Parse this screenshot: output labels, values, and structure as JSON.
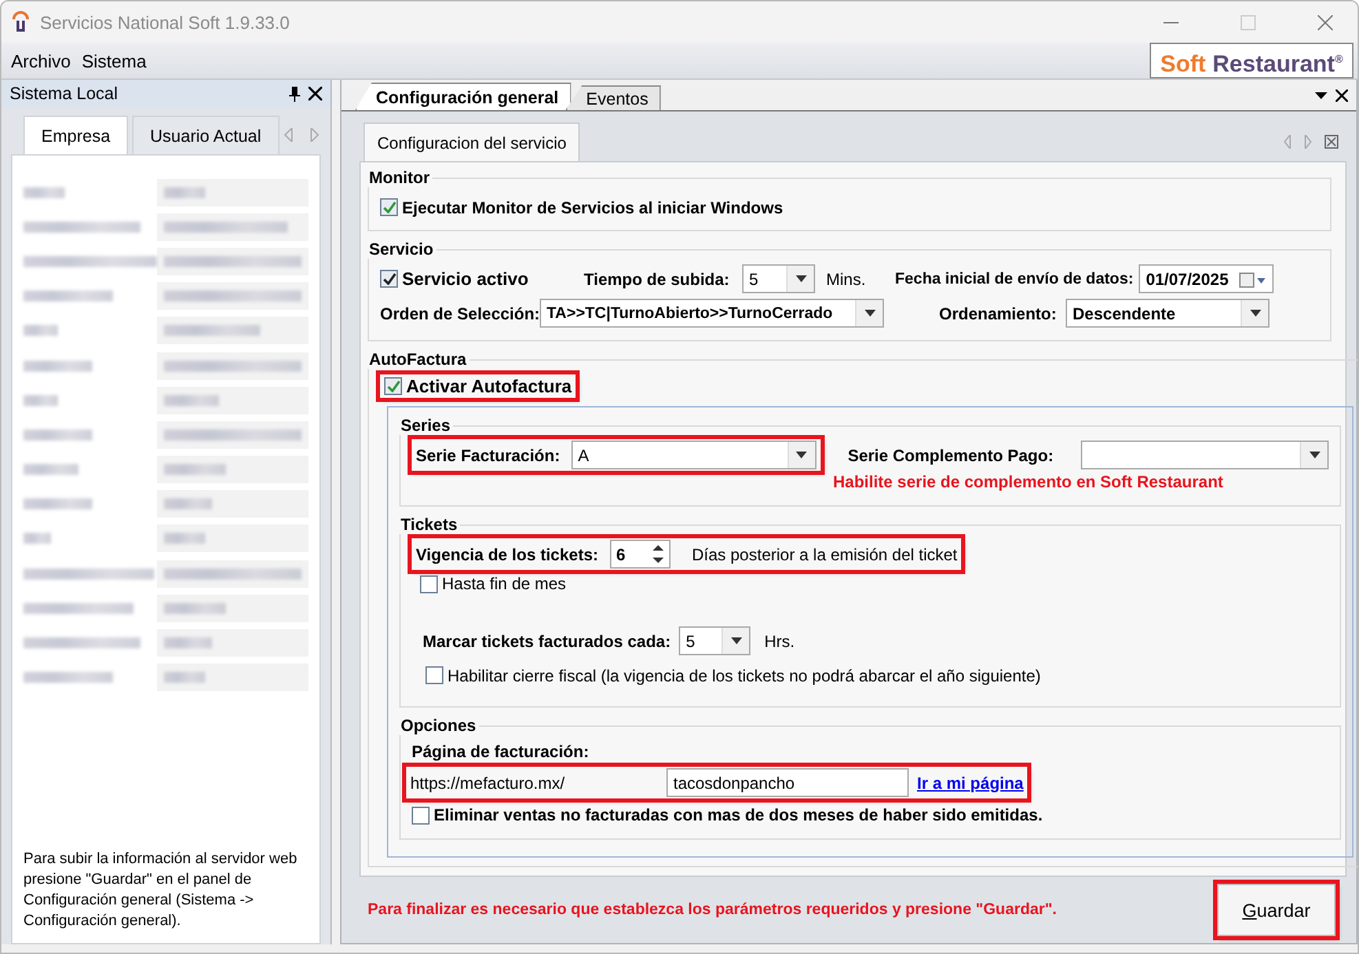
{
  "window": {
    "title": "Servicios National Soft 1.9.33.0"
  },
  "menu": [
    "Archivo",
    "Sistema"
  ],
  "logo": {
    "words": [
      "Soft",
      "Restaurant"
    ],
    "mark": "®"
  },
  "left_panel": {
    "title": "Sistema Local",
    "tabs": [
      {
        "label": "Empresa",
        "selected": true
      },
      {
        "label": "Usuario Actual",
        "selected": false
      }
    ],
    "note": "Para subir la información al servidor web presione \"Guardar\" en el panel de Configuración general (Sistema -> Configuración general)."
  },
  "doc_tabs": [
    {
      "label": "Configuración general",
      "selected": true
    },
    {
      "label": "Eventos",
      "selected": false
    }
  ],
  "inner_tabs": [
    {
      "label": "Configuracion del servicio",
      "selected": true
    }
  ],
  "monitor": {
    "title": "Monitor",
    "checkbox": {
      "label": "Ejecutar Monitor de Servicios al iniciar Windows",
      "checked": true
    }
  },
  "servicio": {
    "title": "Servicio",
    "active": {
      "label": "Servicio activo",
      "checked": true
    },
    "upload_time": {
      "label": "Tiempo de subida:",
      "value": "5",
      "unit": "Mins."
    },
    "start_date": {
      "label": "Fecha inicial de envío de datos:",
      "value": "01/07/2025"
    },
    "order": {
      "label": "Orden de Selección:",
      "value": "TA>>TC|TurnoAbierto>>TurnoCerrado"
    },
    "sorting": {
      "label": "Ordenamiento:",
      "value": "Descendente"
    }
  },
  "autofactura": {
    "title": "AutoFactura",
    "activate": {
      "label": "Activar Autofactura",
      "checked": true,
      "highlighted": true
    },
    "series": {
      "title": "Series",
      "invoice_series": {
        "label": "Serie Facturación:",
        "value": "A",
        "highlighted": true
      },
      "complement_series": {
        "label": "Serie Complemento Pago:"
      },
      "warning": "Habilite serie de complemento en Soft Restaurant"
    },
    "tickets": {
      "title": "Tickets",
      "validity": {
        "label": "Vigencia de los tickets:",
        "value": "6",
        "hint": "Días posterior a la emisión del ticket",
        "highlighted": true
      },
      "month_end": {
        "label": "Hasta fin de mes",
        "checked": false
      },
      "mark_every": {
        "label": "Marcar tickets facturados cada:",
        "value": "5",
        "unit": "Hrs."
      },
      "fiscal_close": {
        "label": "Habilitar cierre fiscal (la vigencia de los tickets no podrá abarcar el año siguiente)",
        "checked": false
      }
    },
    "options": {
      "title": "Opciones",
      "page_label": "Página de facturación:",
      "base_url": "https://mefacturo.mx/",
      "slug": "tacosdonpancho",
      "link": "Ir a mi página",
      "highlighted": true,
      "delete_old": {
        "label": "Eliminar ventas no facturadas con mas de dos meses de haber sido emitidas.",
        "checked": false
      }
    }
  },
  "footer_message": "Para finalizar es necesario que establezca los parámetros requeridos y presione \"Guardar\".",
  "save_button": {
    "label": "Guardar",
    "highlighted": true
  }
}
